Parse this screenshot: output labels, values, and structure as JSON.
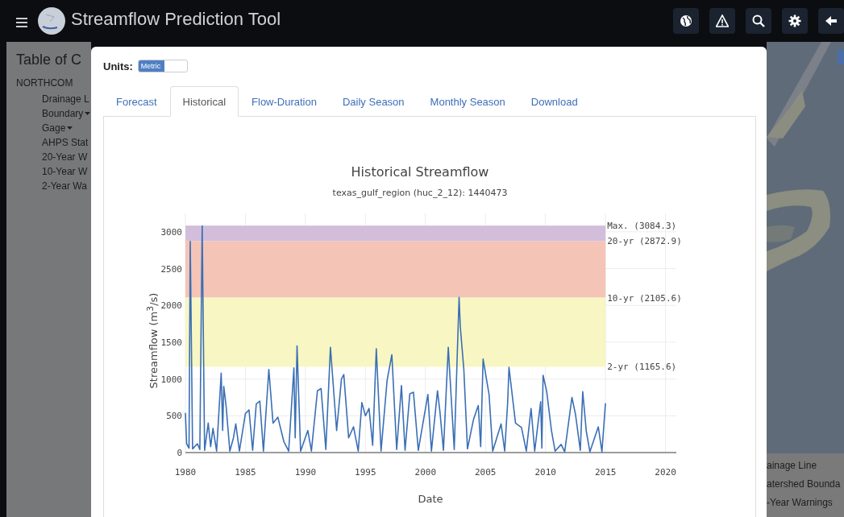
{
  "navbar": {
    "title": "Streamflow Prediction Tool",
    "buttons": [
      {
        "kind": "globe"
      },
      {
        "kind": "warning"
      },
      {
        "kind": "search"
      },
      {
        "kind": "settings"
      },
      {
        "kind": "back"
      }
    ]
  },
  "sidebar": {
    "title": "Table of C",
    "group": "NORTHCOM",
    "items": [
      {
        "label": "Drainage L",
        "kind": "plain"
      },
      {
        "label": "Boundary",
        "kind": "dropdown"
      },
      {
        "label": "Gage",
        "kind": "dropdown"
      },
      {
        "label": "AHPS Stat",
        "kind": "plain"
      },
      {
        "label": "20-Year W",
        "kind": "plain"
      },
      {
        "label": "10-Year W",
        "kind": "plain"
      },
      {
        "label": "2-Year Wa",
        "kind": "plain"
      }
    ]
  },
  "modal": {
    "units": {
      "label": "Units:",
      "value": "Metric",
      "on": true
    },
    "tabs": [
      {
        "label": "Forecast",
        "selected": false
      },
      {
        "label": "Historical",
        "selected": true
      },
      {
        "label": "Flow-Duration",
        "selected": false
      },
      {
        "label": "Daily Season",
        "selected": false
      },
      {
        "label": "Monthly Season",
        "selected": false
      },
      {
        "label": "Download",
        "selected": false
      }
    ],
    "chart": {
      "subtitle": "texas_gulf_region (huc_2_12): 1440473",
      "chart_data": {
        "type": "line",
        "title": "Historical Streamflow",
        "xlabel": "Date",
        "ylabel": "Streamflow (m$^{3}$/s)",
        "x": [
          1980.0,
          1980.1,
          1980.3,
          1980.4,
          1980.6,
          1981.0,
          1981.2,
          1981.4,
          1981.6,
          1981.9,
          1982.1,
          1982.3,
          1982.6,
          1982.98,
          1983.1,
          1983.2,
          1983.4,
          1983.7,
          1984.0,
          1984.2,
          1984.5,
          1985.0,
          1985.3,
          1985.6,
          1985.9,
          1986.2,
          1986.5,
          1986.95,
          1987.3,
          1987.7,
          1988.2,
          1988.6,
          1989.04,
          1989.15,
          1989.3,
          1989.6,
          1990.2,
          1990.5,
          1991.0,
          1991.3,
          1991.7,
          1992.08,
          1992.6,
          1993.0,
          1993.2,
          1993.6,
          1994.0,
          1994.4,
          1994.7,
          1995.0,
          1995.3,
          1995.6,
          1995.9,
          1996.3,
          1996.8,
          1997.2,
          1997.6,
          1998.0,
          1998.3,
          1998.7,
          1999.0,
          1999.4,
          2000.2,
          2000.5,
          2001.0,
          2001.2,
          2001.5,
          2001.9,
          2002.4,
          2002.8,
          2002.9,
          2003.2,
          2003.5,
          2004.0,
          2004.4,
          2004.6,
          2004.8,
          2005.3,
          2005.6,
          2006.3,
          2006.6,
          2006.85,
          2006.96,
          2007.5,
          2008.0,
          2008.4,
          2008.8,
          2009.1,
          2009.6,
          2009.7,
          2009.8,
          2010.1,
          2010.5,
          2010.8,
          2011.3,
          2011.6,
          2012.2,
          2012.5,
          2012.9,
          2013.1,
          2013.4,
          2013.7,
          2014.4,
          2014.7,
          2015.0
        ],
        "series": [
          {
            "color": "#3a6fb5",
            "values": [
              540,
              120,
              60,
              2870,
              50,
              120,
              40,
              3080,
              30,
              400,
              80,
              330,
              20,
              1080,
              300,
              900,
              620,
              20,
              200,
              390,
              20,
              530,
              580,
              30,
              660,
              700,
              20,
              1130,
              400,
              480,
              150,
              20,
              1150,
              200,
              1450,
              20,
              300,
              20,
              840,
              870,
              40,
              1430,
              300,
              1000,
              1060,
              200,
              350,
              20,
              680,
              500,
              600,
              100,
              1410,
              20,
              980,
              1330,
              40,
              910,
              30,
              800,
              820,
              30,
              790,
              20,
              840,
              560,
              30,
              1430,
              40,
              2110,
              1710,
              1130,
              50,
              450,
              640,
              80,
              1270,
              790,
              20,
              390,
              20,
              690,
              1160,
              400,
              340,
              20,
              600,
              20,
              690,
              60,
              1050,
              830,
              300,
              20,
              110,
              10,
              750,
              520,
              30,
              830,
              290,
              10,
              350,
              10,
              670
            ]
          }
        ],
        "xlim": [
          1980,
          2020.9
        ],
        "ylim": [
          0,
          3250
        ],
        "grid": true,
        "xticks": [
          1980,
          1985,
          1990,
          1995,
          2000,
          2005,
          2010,
          2015,
          2020
        ],
        "yticks": [
          0,
          500,
          1000,
          1500,
          2000,
          2500,
          3000
        ],
        "bands": [
          {
            "axis": "y",
            "from": 2872.9,
            "to": 3084.3,
            "color": "#d2bedb"
          },
          {
            "axis": "y",
            "from": 2105.6,
            "to": 2872.9,
            "color": "#f4c4b7"
          },
          {
            "axis": "y",
            "from": 1165.6,
            "to": 2105.6,
            "color": "#f8f6c2"
          }
        ],
        "annotations": [
          "Max. (3084.3)",
          "20-yr (2872.9)",
          "10-yr (2105.6)",
          "2-yr (1165.6)"
        ]
      }
    }
  },
  "legend": {
    "items": [
      "ainage Line",
      "atershed Bounda",
      "-Year Warnings"
    ]
  }
}
